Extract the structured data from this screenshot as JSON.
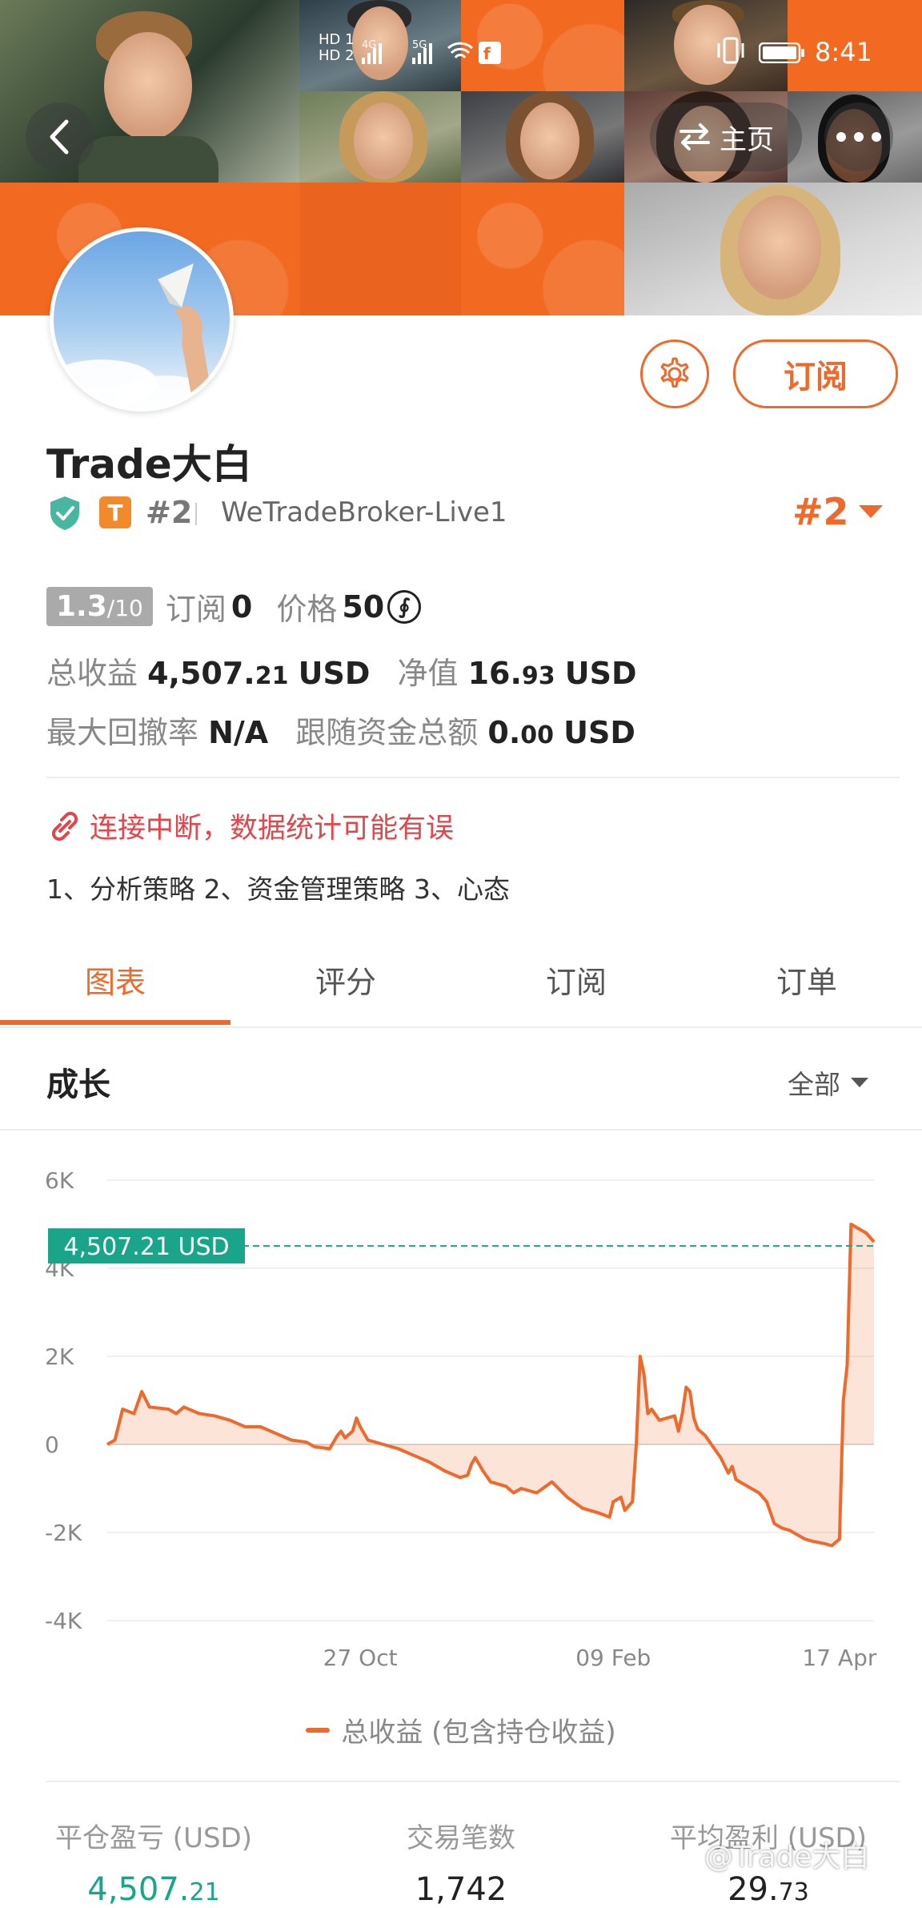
{
  "status_bar": {
    "signal_labels": [
      "HD 1",
      "HD 2",
      "4G",
      "5G"
    ],
    "time": "8:41"
  },
  "header": {
    "home_label": "主页",
    "back_icon": "back-arrow-icon",
    "more_icon": "more-dots-icon",
    "swap_icon": "swap-arrows-icon"
  },
  "profile": {
    "name": "Trade大白",
    "badge_letter": "T",
    "rank_small": "#2",
    "broker": "WeTradeBroker-Live1",
    "rank_large": "#2",
    "subscribe_label": "订阅"
  },
  "stats": {
    "score": "1.3",
    "score_max": "/10",
    "subscribe_label": "订阅",
    "subscribe_count": "0",
    "price_label": "价格",
    "price_value": "50",
    "price_icon_glyph": "∮",
    "total_profit_label": "总收益",
    "total_profit_int": "4,507.",
    "total_profit_dec": "21",
    "total_profit_unit": "USD",
    "net_label": "净值",
    "net_int": "16.",
    "net_dec": "93",
    "net_unit": "USD",
    "drawdown_label": "最大回撤率",
    "drawdown_value": "N/A",
    "follow_label": "跟随资金总额",
    "follow_int": "0.",
    "follow_dec": "00",
    "follow_unit": "USD"
  },
  "warning": "连接中断，数据统计可能有误",
  "description": "1、分析策略 2、资金管理策略 3、心态",
  "tabs": [
    "图表",
    "评分",
    "订阅",
    "订单"
  ],
  "active_tab": 0,
  "section": {
    "title": "成长",
    "filter": "全部"
  },
  "colors": {
    "accent": "#ee6a2c",
    "teal": "#1aa58a",
    "warning": "#e0464b"
  },
  "chart_data": {
    "type": "area",
    "y_ticks": [
      "6K",
      "4K",
      "2K",
      "0",
      "-2K",
      "-4K"
    ],
    "ylim": [
      -4000,
      6000
    ],
    "x_ticks": [
      {
        "label": "27 Oct",
        "x": 0.33
      },
      {
        "label": "09 Feb",
        "x": 0.66
      },
      {
        "label": "17 Apr",
        "x": 0.955
      }
    ],
    "current_value_label": "4,507.21 USD",
    "current_value": 4507.21,
    "series": [
      {
        "name": "总收益 (包含持仓收益)",
        "points": [
          [
            0.0,
            0
          ],
          [
            0.01,
            100
          ],
          [
            0.02,
            800
          ],
          [
            0.035,
            700
          ],
          [
            0.045,
            1200
          ],
          [
            0.055,
            850
          ],
          [
            0.08,
            800
          ],
          [
            0.09,
            700
          ],
          [
            0.1,
            850
          ],
          [
            0.12,
            700
          ],
          [
            0.14,
            650
          ],
          [
            0.16,
            550
          ],
          [
            0.18,
            400
          ],
          [
            0.2,
            400
          ],
          [
            0.22,
            250
          ],
          [
            0.24,
            100
          ],
          [
            0.26,
            50
          ],
          [
            0.27,
            -50
          ],
          [
            0.29,
            -100
          ],
          [
            0.3,
            200
          ],
          [
            0.305,
            300
          ],
          [
            0.31,
            150
          ],
          [
            0.32,
            300
          ],
          [
            0.325,
            600
          ],
          [
            0.33,
            400
          ],
          [
            0.34,
            100
          ],
          [
            0.36,
            0
          ],
          [
            0.38,
            -100
          ],
          [
            0.4,
            -250
          ],
          [
            0.42,
            -400
          ],
          [
            0.44,
            -600
          ],
          [
            0.46,
            -750
          ],
          [
            0.47,
            -700
          ],
          [
            0.475,
            -450
          ],
          [
            0.48,
            -300
          ],
          [
            0.49,
            -600
          ],
          [
            0.5,
            -850
          ],
          [
            0.52,
            -950
          ],
          [
            0.53,
            -1100
          ],
          [
            0.54,
            -1000
          ],
          [
            0.56,
            -1100
          ],
          [
            0.58,
            -850
          ],
          [
            0.6,
            -1200
          ],
          [
            0.62,
            -1450
          ],
          [
            0.64,
            -1550
          ],
          [
            0.655,
            -1650
          ],
          [
            0.66,
            -1300
          ],
          [
            0.67,
            -1200
          ],
          [
            0.675,
            -1500
          ],
          [
            0.68,
            -1400
          ],
          [
            0.685,
            -1300
          ],
          [
            0.69,
            0
          ],
          [
            0.695,
            2000
          ],
          [
            0.7,
            1600
          ],
          [
            0.705,
            700
          ],
          [
            0.71,
            800
          ],
          [
            0.72,
            550
          ],
          [
            0.73,
            600
          ],
          [
            0.74,
            650
          ],
          [
            0.745,
            300
          ],
          [
            0.75,
            700
          ],
          [
            0.755,
            1300
          ],
          [
            0.76,
            1200
          ],
          [
            0.765,
            600
          ],
          [
            0.77,
            350
          ],
          [
            0.78,
            200
          ],
          [
            0.79,
            -50
          ],
          [
            0.8,
            -300
          ],
          [
            0.81,
            -650
          ],
          [
            0.815,
            -500
          ],
          [
            0.82,
            -800
          ],
          [
            0.83,
            -900
          ],
          [
            0.84,
            -1000
          ],
          [
            0.85,
            -1100
          ],
          [
            0.86,
            -1300
          ],
          [
            0.87,
            -1800
          ],
          [
            0.88,
            -1900
          ],
          [
            0.89,
            -1950
          ],
          [
            0.9,
            -2050
          ],
          [
            0.91,
            -2150
          ],
          [
            0.92,
            -2200
          ],
          [
            0.935,
            -2250
          ],
          [
            0.945,
            -2300
          ],
          [
            0.955,
            -2150
          ],
          [
            0.96,
            1000
          ],
          [
            0.965,
            1800
          ],
          [
            0.97,
            5000
          ],
          [
            0.98,
            4900
          ],
          [
            0.99,
            4800
          ],
          [
            1.0,
            4600
          ]
        ]
      }
    ]
  },
  "footer": [
    {
      "label": "平仓盈亏 (USD)",
      "value_int": "4,507.",
      "value_dec": "21",
      "value_color": "#1aa58a"
    },
    {
      "label": "交易笔数",
      "value_int": "1,742",
      "value_dec": "",
      "value_color": "#222"
    },
    {
      "label": "平均盈利 (USD)",
      "value_int": "29.",
      "value_dec": "73",
      "value_color": "#222"
    }
  ],
  "watermark": "@Trade大白"
}
